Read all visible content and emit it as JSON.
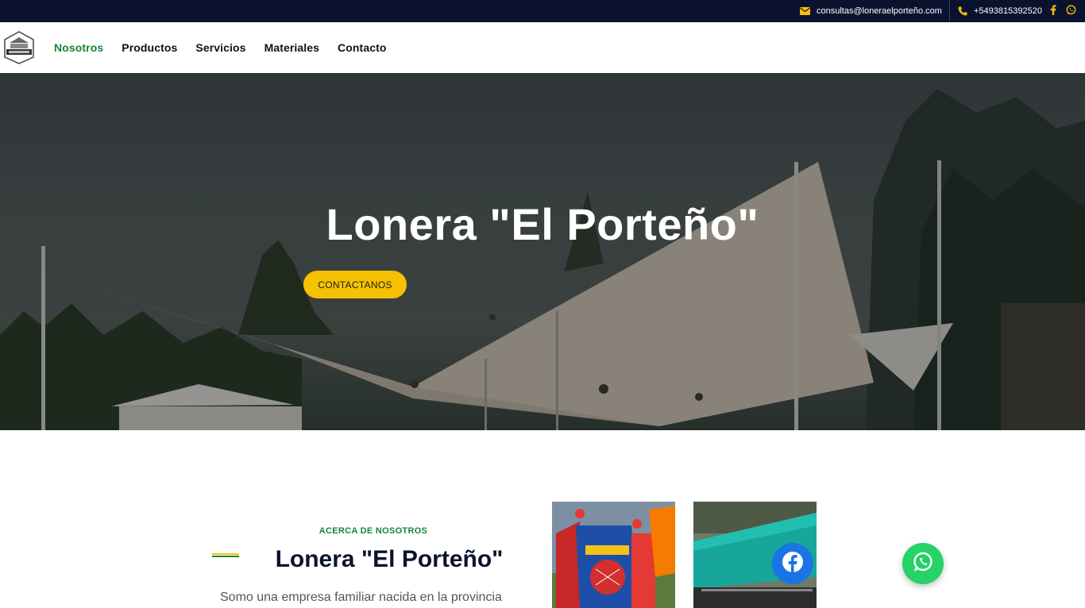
{
  "topbar": {
    "email": "consultas@loneraelporteño.com",
    "phone": "+5493815392520",
    "icons": [
      "envelope-icon",
      "phone-icon",
      "facebook-icon",
      "whatsapp-icon"
    ]
  },
  "nav": {
    "logo_alt": "Lonera El Porteño logo",
    "items": [
      "Nosotros",
      "Productos",
      "Servicios",
      "Materiales",
      "Contacto"
    ],
    "active": "Nosotros"
  },
  "hero": {
    "title": "Lonera \"El Porteño\"",
    "cta": "CONTACTANOS"
  },
  "about": {
    "tag": "ACERCA DE NOSOTROS",
    "title": "Lonera \"El Porteño\"",
    "text": "Somo una empresa familiar nacida en la provincia"
  },
  "colors": {
    "topbar_bg": "#0b1230",
    "accent_green": "#16843a",
    "accent_yellow": "#f5c100",
    "facebook": "#1b74e4",
    "whatsapp": "#25d366"
  }
}
